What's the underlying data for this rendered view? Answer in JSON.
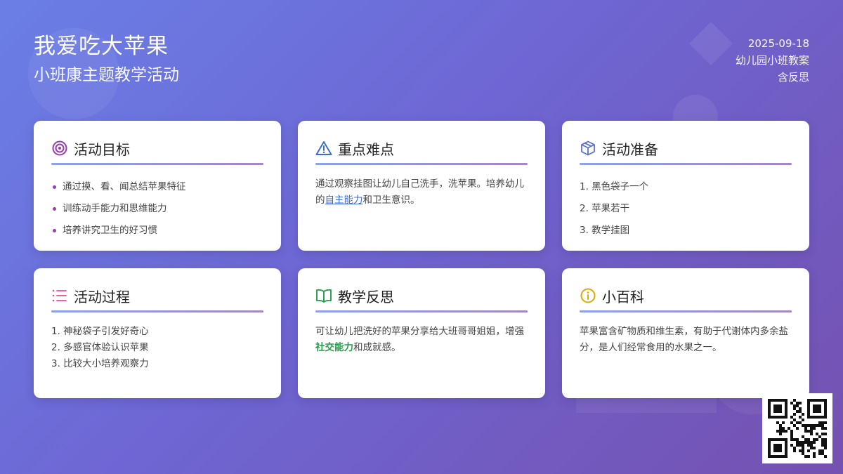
{
  "header": {
    "title": "我爱吃大苹果",
    "subtitle": "小班康主题教学活动",
    "date": "2025-09-18",
    "category": "幼儿园小班教案",
    "note": "含反思"
  },
  "cards": {
    "goals": {
      "title": "活动目标",
      "icon": "target-icon",
      "items": [
        "通过摸、看、闻总结苹果特征",
        "训练动手能力和思维能力",
        "培养讲究卫生的好习惯"
      ]
    },
    "keypoints": {
      "title": "重点难点",
      "icon": "warning-icon",
      "text_before": "通过观察挂图让幼儿自己洗手，洗苹果。培养幼儿的",
      "link": "自主能力",
      "text_after": "和卫生意识。"
    },
    "preparation": {
      "title": "活动准备",
      "icon": "box-icon",
      "items": [
        "1. 黑色袋子一个",
        "2. 苹果若干",
        "3. 教学挂图"
      ]
    },
    "process": {
      "title": "活动过程",
      "icon": "list-icon",
      "items": [
        "1. 神秘袋子引发好奇心",
        "2. 多感官体验认识苹果",
        "3. 比较大小培养观察力"
      ]
    },
    "reflection": {
      "title": "教学反思",
      "icon": "book-icon",
      "text_before": "可让幼儿把洗好的苹果分享给大班哥哥姐姐，增强",
      "highlight": "社交能力",
      "text_after": "和成就感。"
    },
    "encyclopedia": {
      "title": "小百科",
      "icon": "info-icon",
      "text": "苹果富含矿物质和维生素，有助于代谢体内多余盐分，是人们经常食用的水果之一。"
    }
  },
  "qr": {
    "icon": "qr-code-icon"
  },
  "colors": {
    "bg_start": "#6a7fe6",
    "bg_end": "#7551b0",
    "rule_start": "#8aa3ea",
    "rule_end": "#a586c6",
    "link": "#3a6fd0",
    "green": "#22a047"
  }
}
